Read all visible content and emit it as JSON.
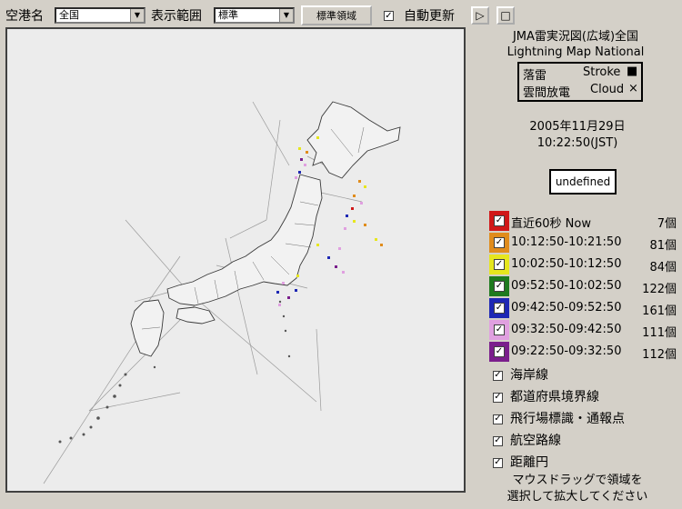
{
  "toolbar": {
    "airport_label": "空港名",
    "airport_value": "全国",
    "range_label": "表示範囲",
    "range_value": "標準",
    "standard_button": "標準領域",
    "auto_update_label": "自動更新",
    "auto_update_checked": "✓",
    "play_glyph": "▷",
    "stop_glyph": "□"
  },
  "side": {
    "title": "JMA雷実況図(広域)全国",
    "subtitle": "Lightning Map National",
    "legend": {
      "stroke_jp": "落雷",
      "stroke_en": "Stroke",
      "stroke_mark": "■",
      "cloud_jp": "雲間放電",
      "cloud_en": "Cloud",
      "cloud_mark": "×"
    },
    "date": "2005年11月29日",
    "time": "10:22:50(JST)",
    "status": "undefined",
    "time_bins": [
      {
        "range": "直近60秒 Now",
        "count": "7個",
        "color": "#d01818"
      },
      {
        "range": "10:12:50-10:21:50",
        "count": "81個",
        "color": "#e08c1c"
      },
      {
        "range": "10:02:50-10:12:50",
        "count": "84個",
        "color": "#e6e61e"
      },
      {
        "range": "09:52:50-10:02:50",
        "count": "122個",
        "color": "#1e7a1e"
      },
      {
        "range": "09:42:50-09:52:50",
        "count": "161個",
        "color": "#1e28b4"
      },
      {
        "range": "09:32:50-09:42:50",
        "count": "111個",
        "color": "#e0a0e0"
      },
      {
        "range": "09:22:50-09:32:50",
        "count": "112個",
        "color": "#7a1e8c"
      }
    ],
    "layers": [
      {
        "label": "海岸線"
      },
      {
        "label": "都道府県境界線"
      },
      {
        "label": "飛行場標識・通報点"
      },
      {
        "label": "航空路線"
      },
      {
        "label": "距離円"
      }
    ],
    "hint_line1": "マウスドラッグで領域を",
    "hint_line2": "選択して拡大してください"
  },
  "icons": {
    "dropdown": "dropdown-arrow-icon",
    "check": "✓"
  }
}
